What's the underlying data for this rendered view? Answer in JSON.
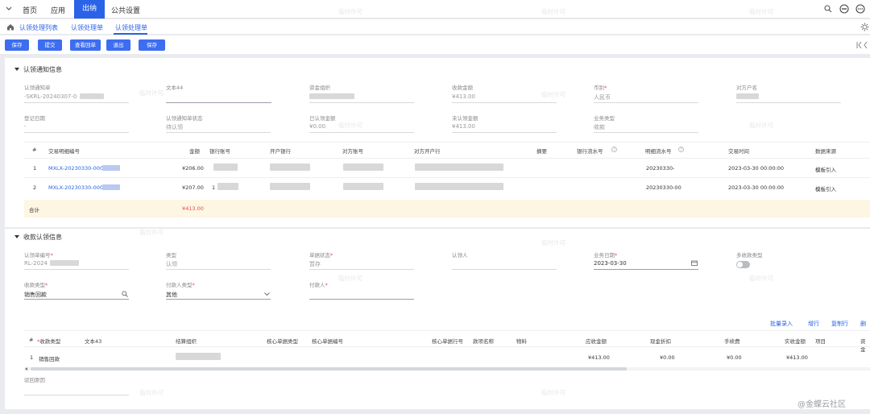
{
  "nav": {
    "home": "首页",
    "apps": "应用",
    "active": "出纳",
    "settings": "公共设置"
  },
  "breadcrumb": {
    "list": "认领处理列表",
    "mid": "认领处理单",
    "current": "认领处理单"
  },
  "toolbar": {
    "save": "保存",
    "submit": "提交",
    "view_bill": "查看回单",
    "exit": "退出",
    "save2": "保存"
  },
  "notice": {
    "title": "认领通知信息",
    "fields": [
      {
        "label": "认领通知单",
        "value": "-SKRL-20240307-0"
      },
      {
        "label": "文本44",
        "value": ""
      },
      {
        "label": "资金组织",
        "value": ""
      },
      {
        "label": "收款金额",
        "value": "¥413.00"
      },
      {
        "label": "币别",
        "value": "人民币"
      },
      {
        "label": "对方户名",
        "value": ""
      },
      {
        "label": "登记日期",
        "value": "-"
      },
      {
        "label": "认领通知单状态",
        "value": "待认领"
      },
      {
        "label": "已认领金额",
        "value": "¥0.00"
      },
      {
        "label": "未认领金额",
        "value": "¥413.00"
      },
      {
        "label": "业务类型",
        "value": "收款"
      }
    ],
    "table": {
      "headers": [
        "#",
        "交易明细编号",
        "金额",
        "银行账号",
        "开户银行",
        "对方账号",
        "对方开户行",
        "摘要",
        "银行流水号",
        "明细流水号",
        "交易时间",
        "数据来源"
      ],
      "rows": [
        {
          "idx": "1",
          "code": "MXLX-20230330-0000",
          "amount": "¥206.00",
          "bank_acct": "",
          "bank": "",
          "opp_acct": "",
          "opp_bank": "",
          "memo": "",
          "bank_serial": "",
          "detail_serial": "20230330-",
          "time": "2023-03-30 00:00:00",
          "source": "模板引入"
        },
        {
          "idx": "2",
          "code": "MXLX-20230330-0000",
          "amount": "¥207.00",
          "bank_acct": "1",
          "bank": "",
          "opp_acct": "",
          "opp_bank": "",
          "memo": "",
          "bank_serial": "",
          "detail_serial": "20230330-00",
          "time": "2023-03-30 00:00:00",
          "source": "模板引入"
        }
      ],
      "total_label": "合计",
      "total_value": "¥413.00"
    }
  },
  "claim": {
    "title": "收款认领信息",
    "fields": [
      {
        "label": "认领单编号",
        "value": "RL-2024"
      },
      {
        "label": "类型",
        "value": "认领"
      },
      {
        "label": "单据状态",
        "value": "暂存"
      },
      {
        "label": "认领人",
        "value": ""
      },
      {
        "label": "业务日期",
        "value": "2023-03-30"
      },
      {
        "label": "多收款类型",
        "value": ""
      },
      {
        "label": "收款类型",
        "value": "销售回款"
      },
      {
        "label": "付款人类型",
        "value": "其他"
      },
      {
        "label": "付款人",
        "value": ""
      }
    ],
    "actions": {
      "batch": "批量录入",
      "add": "增行",
      "copy": "复制行",
      "more": "删"
    },
    "table": {
      "headers": [
        "#",
        "收款类型",
        "文本43",
        "结算组织",
        "核心单据类型",
        "核心单据编号",
        "核心单据行号",
        "款项名称",
        "物料",
        "应收金额",
        "现金折扣",
        "手续费",
        "实收金额",
        "项目",
        "资金"
      ],
      "rows": [
        {
          "idx": "1",
          "type": "销售回款",
          "text43": "",
          "org": "",
          "core_type": "",
          "core_no": "",
          "core_line": "",
          "item": "",
          "material": "",
          "receivable": "¥413.00",
          "discount": "¥0.00",
          "fee": "¥0.00",
          "received": "¥413.00",
          "project": "",
          "fund": ""
        }
      ]
    },
    "reject_label": "驳回原因"
  },
  "watermark": "临时许可",
  "footer_logo": "@金蝶云社区",
  "colors": {
    "primary": "#2a62e8",
    "button": "#3d6df0",
    "total_bg": "#fdf6e3",
    "required": "#e84a4a"
  }
}
